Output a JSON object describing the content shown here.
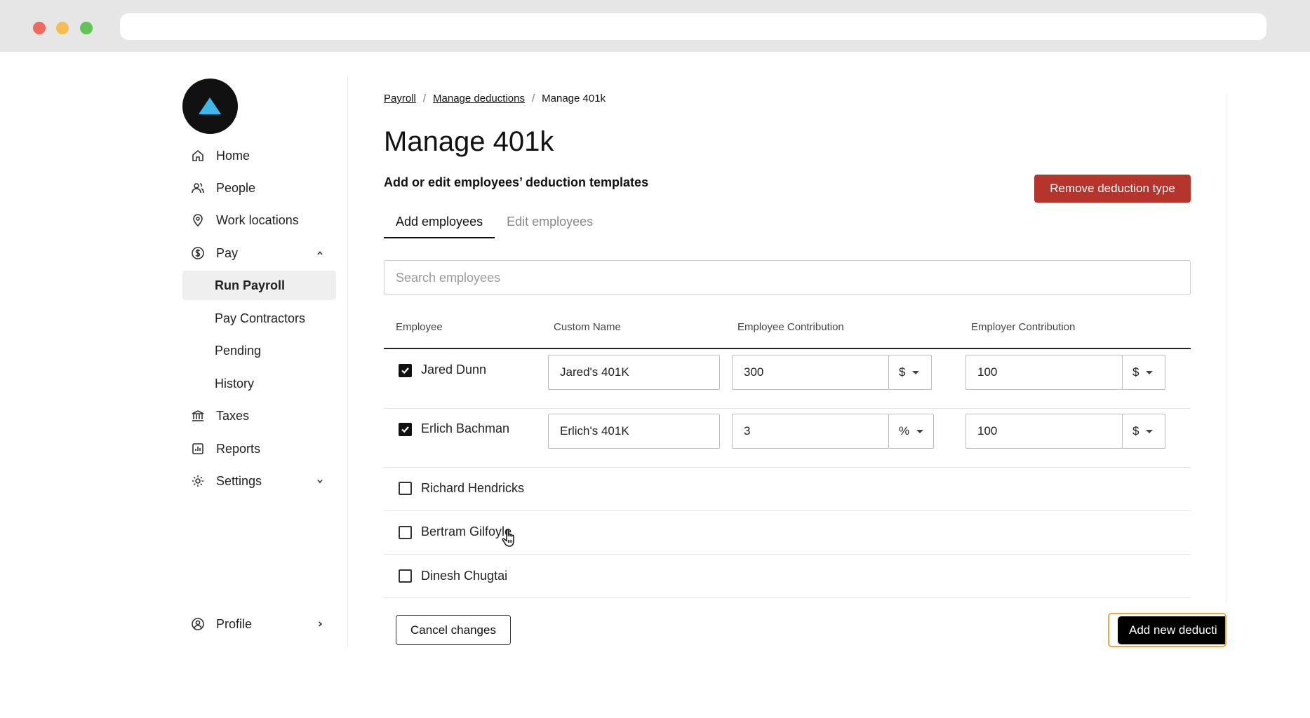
{
  "sidebar": {
    "items": [
      {
        "label": "Home",
        "icon": "home-icon"
      },
      {
        "label": "People",
        "icon": "people-icon"
      },
      {
        "label": "Work locations",
        "icon": "map-pin-icon"
      },
      {
        "label": "Pay",
        "icon": "dollar-circle-icon",
        "expanded": true
      },
      {
        "label": "Run Payroll",
        "active": true
      },
      {
        "label": "Pay Contractors"
      },
      {
        "label": "Pending"
      },
      {
        "label": "History"
      },
      {
        "label": "Taxes",
        "icon": "bank-icon"
      },
      {
        "label": "Reports",
        "icon": "bar-chart-icon"
      },
      {
        "label": "Settings",
        "icon": "gear-icon",
        "expanded": false
      }
    ],
    "profile": {
      "label": "Profile",
      "icon": "user-circle-icon"
    }
  },
  "breadcrumb": [
    "Payroll",
    "Manage deductions",
    "Manage 401k"
  ],
  "page": {
    "title": "Manage 401k",
    "subtitle": "Add or edit employees’ deduction templates",
    "remove_button": "Remove deduction type"
  },
  "tabs": [
    {
      "label": "Add employees",
      "active": true
    },
    {
      "label": "Edit employees",
      "active": false
    }
  ],
  "search": {
    "placeholder": "Search employees"
  },
  "table": {
    "headers": [
      "Employee",
      "Custom Name",
      "Employee Contribution",
      "Employer Contribution"
    ],
    "rows": [
      {
        "name": "Jared Dunn",
        "checked": true,
        "custom_name": "Jared's 401K",
        "employee_amount": "300",
        "employee_unit": "$",
        "employer_amount": "100",
        "employer_unit": "$"
      },
      {
        "name": "Erlich Bachman",
        "checked": true,
        "custom_name": "Erlich's 401K",
        "employee_amount": "3",
        "employee_unit": "%",
        "employer_amount": "100",
        "employer_unit": "$"
      },
      {
        "name": "Richard Hendricks",
        "checked": false
      },
      {
        "name": "Bertram Gilfoyle",
        "checked": false
      },
      {
        "name": "Dinesh Chugtai",
        "checked": false
      }
    ]
  },
  "footer": {
    "cancel_button": "Cancel changes",
    "add_button": "Add new deducti"
  },
  "colors": {
    "danger": "#b5342c",
    "primary": "#000000",
    "focus_ring": "#f0a644",
    "logo_accent": "#3db8e8"
  }
}
